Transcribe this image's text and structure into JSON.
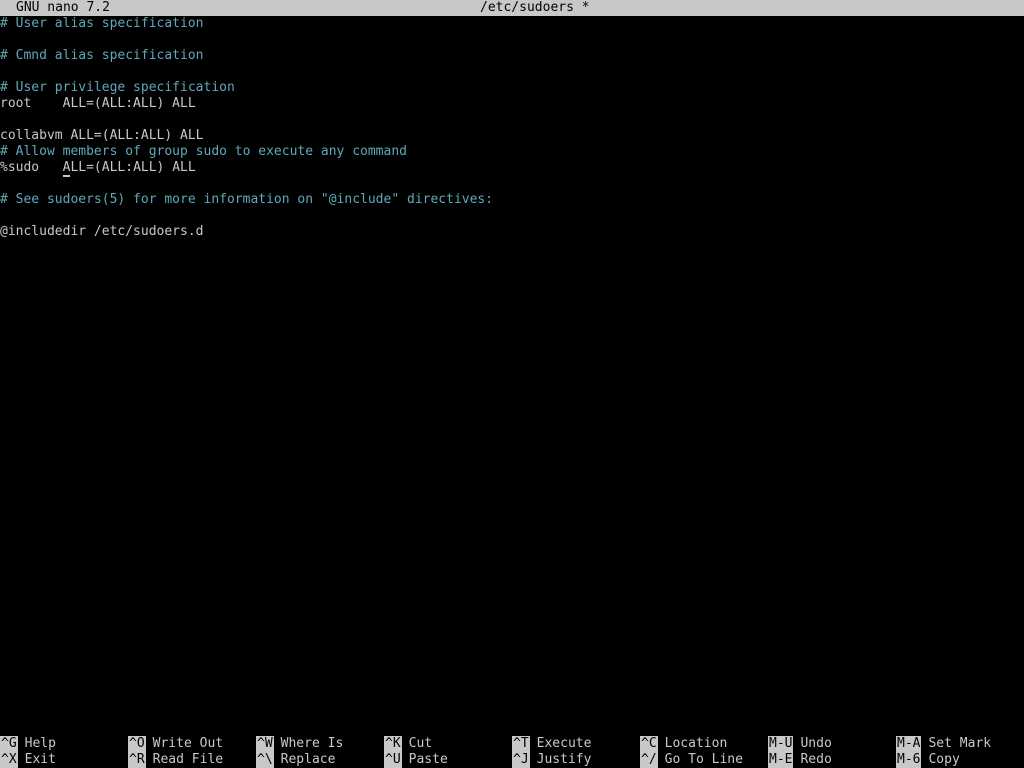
{
  "titlebar": {
    "app": "GNU nano 7.2",
    "file": "/etc/sudoers *"
  },
  "editor": {
    "lines": [
      {
        "text": "# User alias specification",
        "type": "comment"
      },
      {
        "text": "",
        "type": "blank"
      },
      {
        "text": "# Cmnd alias specification",
        "type": "comment"
      },
      {
        "text": "",
        "type": "blank"
      },
      {
        "text": "# User privilege specification",
        "type": "comment"
      },
      {
        "text": "root    ALL=(ALL:ALL) ALL",
        "type": "code"
      },
      {
        "text": "",
        "type": "blank"
      },
      {
        "text": "collabvm ALL=(ALL:ALL) ALL",
        "type": "code"
      },
      {
        "text": "# Allow members of group sudo to execute any command",
        "type": "comment"
      },
      {
        "text": "%sudo   ALL=(ALL:ALL) ALL",
        "type": "code",
        "cursor_col": 8
      },
      {
        "text": "",
        "type": "blank"
      },
      {
        "text": "# See sudoers(5) for more information on \"@include\" directives:",
        "type": "comment"
      },
      {
        "text": "",
        "type": "blank"
      },
      {
        "text": "@includedir /etc/sudoers.d",
        "type": "code"
      }
    ]
  },
  "shortcuts": [
    [
      {
        "key": "^G",
        "label": "Help"
      },
      {
        "key": "^O",
        "label": "Write Out"
      },
      {
        "key": "^W",
        "label": "Where Is"
      },
      {
        "key": "^K",
        "label": "Cut"
      },
      {
        "key": "^T",
        "label": "Execute"
      },
      {
        "key": "^C",
        "label": "Location"
      },
      {
        "key": "M-U",
        "label": "Undo"
      },
      {
        "key": "M-A",
        "label": "Set Mark"
      }
    ],
    [
      {
        "key": "^X",
        "label": "Exit"
      },
      {
        "key": "^R",
        "label": "Read File"
      },
      {
        "key": "^\\",
        "label": "Replace"
      },
      {
        "key": "^U",
        "label": "Paste"
      },
      {
        "key": "^J",
        "label": "Justify"
      },
      {
        "key": "^/",
        "label": "Go To Line"
      },
      {
        "key": "M-E",
        "label": "Redo"
      },
      {
        "key": "M-6",
        "label": "Copy"
      }
    ]
  ]
}
